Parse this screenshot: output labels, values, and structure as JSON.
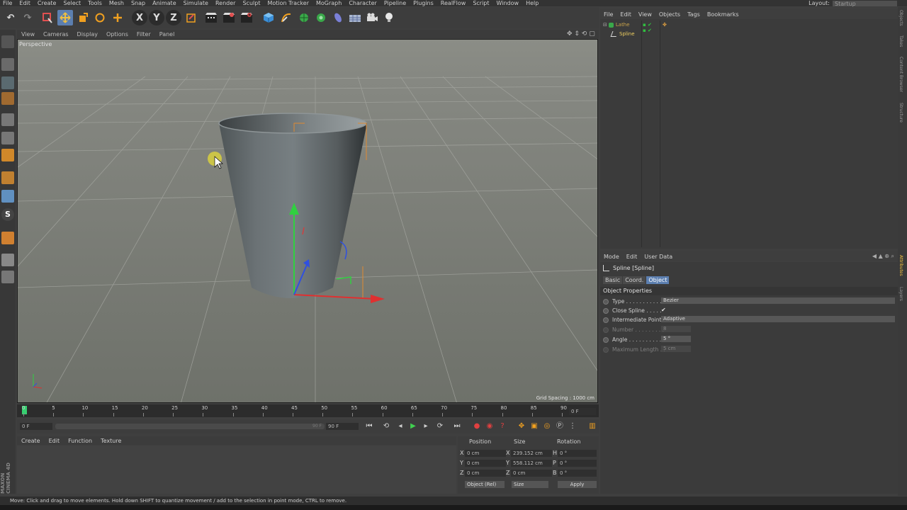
{
  "menu": [
    "File",
    "Edit",
    "Create",
    "Select",
    "Tools",
    "Mesh",
    "Snap",
    "Animate",
    "Simulate",
    "Render",
    "Sculpt",
    "Motion Tracker",
    "MoGraph",
    "Character",
    "Pipeline",
    "Plugins",
    "RealFlow",
    "Script",
    "Window",
    "Help"
  ],
  "layout": {
    "label": "Layout:",
    "value": "Startup"
  },
  "toolbar": {
    "x_axis": "X",
    "y_axis": "Y",
    "z_axis": "Z"
  },
  "viewport": {
    "menu": [
      "View",
      "Cameras",
      "Display",
      "Options",
      "Filter",
      "Panel"
    ],
    "label": "Perspective",
    "grid_spacing": "Grid Spacing : 1000 cm"
  },
  "timeline": {
    "ticks": [
      "0",
      "5",
      "10",
      "15",
      "20",
      "25",
      "30",
      "35",
      "40",
      "45",
      "50",
      "55",
      "60",
      "65",
      "70",
      "75",
      "80",
      "85",
      "90"
    ],
    "current_frame": "0 F",
    "start": "0 F",
    "range_end_value": "90 F",
    "end": "90 F"
  },
  "material_menu": [
    "Create",
    "Edit",
    "Function",
    "Texture"
  ],
  "coords": {
    "headers": [
      "Position",
      "Size",
      "Rotation"
    ],
    "rows": [
      {
        "axis": "X",
        "pos": "0 cm",
        "size_axis": "X",
        "size": "239.152 cm",
        "rot_axis": "H",
        "rot": "0 °"
      },
      {
        "axis": "Y",
        "pos": "0 cm",
        "size_axis": "Y",
        "size": "558.112 cm",
        "rot_axis": "P",
        "rot": "0 °"
      },
      {
        "axis": "Z",
        "pos": "0 cm",
        "size_axis": "Z",
        "size": "0 cm",
        "rot_axis": "B",
        "rot": "0 °"
      }
    ],
    "mode": "Object (Rel)",
    "size_mode": "Size",
    "apply": "Apply"
  },
  "status": "Move: Click and drag to move elements. Hold down SHIFT to quantize movement / add to the selection in point mode, CTRL to remove.",
  "objects_menu": [
    "File",
    "Edit",
    "View",
    "Objects",
    "Tags",
    "Bookmarks"
  ],
  "objects": [
    {
      "name": "Lathe",
      "color": "#c8a24a"
    },
    {
      "name": "Spline",
      "color": "#f0d060"
    }
  ],
  "attributes": {
    "menu": [
      "Mode",
      "Edit",
      "User Data"
    ],
    "title": "Spline [Spline]",
    "tabs": [
      "Basic",
      "Coord.",
      "Object"
    ],
    "active_tab": "Object",
    "section": "Object Properties",
    "props": [
      {
        "label": "Type . . . . . . . . . . . . .",
        "value": "Bezier"
      },
      {
        "label": "Close Spline . . . . .",
        "value": "✔"
      },
      {
        "label": "Intermediate Points",
        "value": "Adaptive"
      },
      {
        "label": "Number . . . . . . . . .",
        "value": "8"
      },
      {
        "label": "Angle . . . . . . . . . . .",
        "value": "5 °"
      },
      {
        "label": "Maximum Length . .",
        "value": "5 cm"
      }
    ]
  },
  "side_tabs": [
    "Objects",
    "Takes",
    "Content Browser",
    "Structure",
    "Attributes",
    "Layers"
  ],
  "brand": "MAXON CINEMA 4D",
  "colors": {
    "accent": "#5c7fb0",
    "object_name": "#f0d060",
    "timeline_marker": "#36d070"
  }
}
